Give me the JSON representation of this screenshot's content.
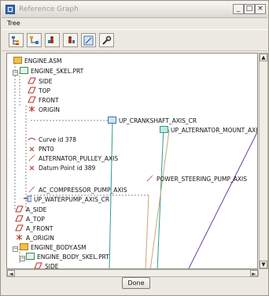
{
  "window": {
    "title": "Reference Graph",
    "minimize_glyph": "_",
    "maximize_glyph": "□",
    "close_glyph": "×"
  },
  "menu": {
    "tree_label": "Tree"
  },
  "toolbar": {
    "tools": [
      "tree-view-icon",
      "hierarchy-icon",
      "parent-refs-icon",
      "child-refs-icon",
      "zoom-fit-icon",
      "wrench-icon"
    ]
  },
  "tree": {
    "root": "ENGINE.ASM",
    "skel": "ENGINE_SKEL.PRT",
    "skel_children": [
      "SIDE",
      "TOP",
      "FRONT",
      "ORIGIN"
    ],
    "refs": [
      "Curve id 378",
      "PNT0",
      "ALTERNATOR_PULLEY_AXIS",
      "Datum Point id 389",
      "AC_COMPRESSOR_PUMP_AXIS"
    ],
    "waterpump": "UP_WATERPUMP_AXIS_CR",
    "asm_datums": [
      "A_SIDE",
      "A_TOP",
      "A_FRONT",
      "A_ORIGIN"
    ],
    "body_asm": "ENGINE_BODY.ASM",
    "body_skel": "ENGINE_BODY_SKEL.PRT",
    "cut_label": "SIDE"
  },
  "graph_nodes": {
    "crankshaft": "UP_CRANKSHAFT_AXIS_CR",
    "alternator_mount": "UP_ALTERNATOR_MOUNT_AXIS",
    "power_steering": "POWER_STEERING_PUMP_AXIS"
  },
  "colors": {
    "datum_plane": "#b4311f",
    "datum_axis": "#c0392b",
    "link_teal": "#2f9a94",
    "link_purple": "#6b3fa0",
    "link_tan": "#c9a577",
    "assembly_icon": "#e0a020"
  },
  "buttons": {
    "done": "Done"
  },
  "scroll": {
    "up": "▲",
    "down": "▼",
    "left": "◄",
    "right": "►"
  }
}
